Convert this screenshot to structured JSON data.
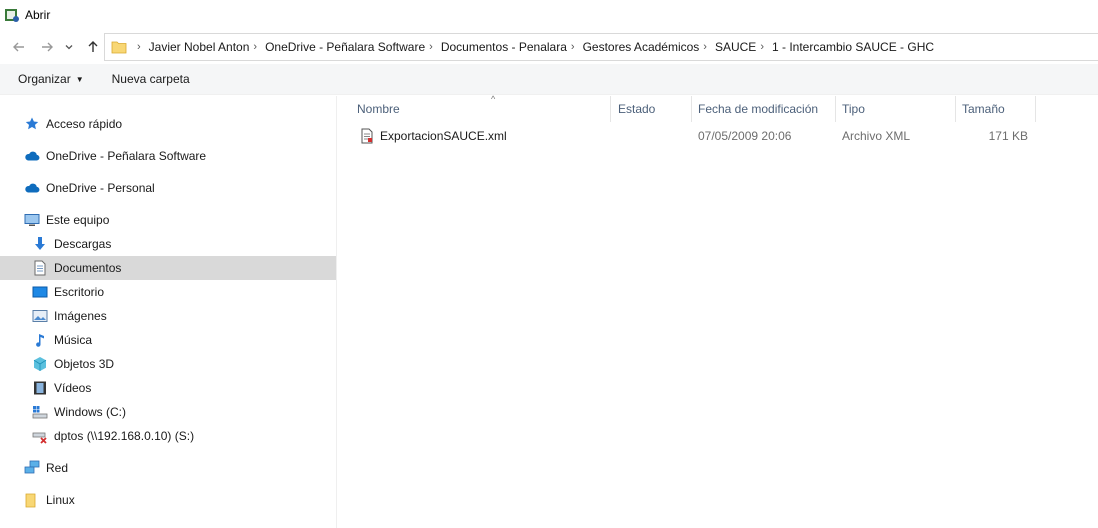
{
  "window": {
    "title": "Abrir"
  },
  "address": {
    "crumbs": [
      "Javier Nobel Anton",
      "OneDrive - Peñalara Software",
      "Documentos - Penalara",
      "Gestores Académicos",
      "SAUCE",
      "1 - Intercambio SAUCE - GHC"
    ]
  },
  "toolbar": {
    "organize_label": "Organizar",
    "new_folder_label": "Nueva carpeta"
  },
  "sidebar": {
    "items": [
      {
        "label": "Acceso rápido",
        "icon": "star-icon"
      },
      {
        "label": "OneDrive - Peñalara Software",
        "icon": "cloud-icon"
      },
      {
        "label": "OneDrive - Personal",
        "icon": "cloud-icon"
      },
      {
        "label": "Este equipo",
        "icon": "computer-icon"
      },
      {
        "label": "Descargas",
        "icon": "download-icon"
      },
      {
        "label": "Documentos",
        "icon": "document-icon"
      },
      {
        "label": "Escritorio",
        "icon": "desktop-icon"
      },
      {
        "label": "Imágenes",
        "icon": "image-icon"
      },
      {
        "label": "Música",
        "icon": "music-icon"
      },
      {
        "label": "Objetos 3D",
        "icon": "cube-icon"
      },
      {
        "label": "Vídeos",
        "icon": "film-icon"
      },
      {
        "label": "Windows  (C:)",
        "icon": "drive-icon"
      },
      {
        "label": "dptos (\\\\192.168.0.10) (S:)",
        "icon": "network-drive-icon"
      },
      {
        "label": "Red",
        "icon": "network-icon"
      },
      {
        "label": "Linux",
        "icon": "folder-icon"
      }
    ]
  },
  "columns": {
    "name": "Nombre",
    "status": "Estado",
    "modified": "Fecha de modificación",
    "type": "Tipo",
    "size": "Tamaño"
  },
  "files": [
    {
      "name": "ExportacionSAUCE.xml",
      "status": "",
      "modified": "07/05/2009 20:06",
      "type": "Archivo XML",
      "size": "171 KB"
    }
  ],
  "colors": {
    "selected_bg": "#d9d9d9",
    "toolbar_bg": "#f5f6f7",
    "header_text": "#4c607a",
    "onedrive_blue": "#0f6cbd",
    "folder_yellow": "#f8d775"
  }
}
